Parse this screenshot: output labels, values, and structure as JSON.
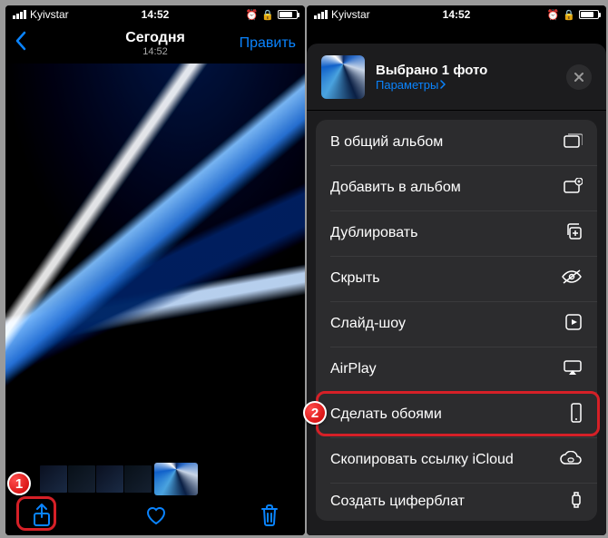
{
  "status": {
    "carrier": "Kyivstar",
    "time": "14:52"
  },
  "left": {
    "nav_title": "Сегодня",
    "nav_subtitle": "14:52",
    "edit_label": "Править"
  },
  "sheet": {
    "title": "Выбрано 1 фото",
    "params_link": "Параметры",
    "rows": [
      "В общий альбом",
      "Добавить в альбом",
      "Дублировать",
      "Скрыть",
      "Слайд-шоу",
      "AirPlay",
      "Сделать обоями",
      "Скопировать ссылку iCloud",
      "Создать циферблат"
    ]
  },
  "badges": {
    "one": "1",
    "two": "2"
  }
}
